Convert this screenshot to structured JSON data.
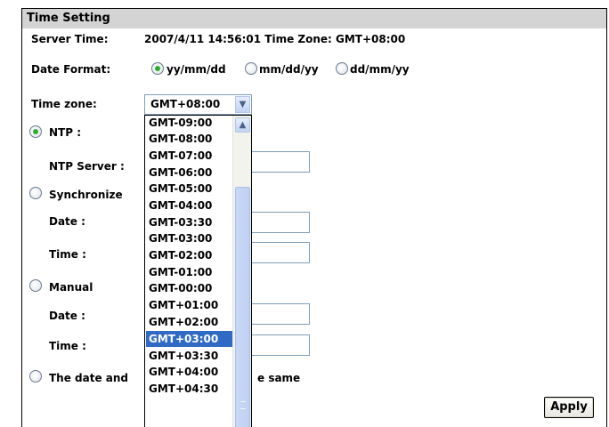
{
  "section_title": "Time Setting",
  "server_time": {
    "label": "Server Time:",
    "value": "2007/4/11 14:56:01 Time Zone: GMT+08:00"
  },
  "date_format": {
    "label": "Date Format:",
    "options": [
      "yy/mm/dd",
      "mm/dd/yy",
      "dd/mm/yy"
    ],
    "selected": "yy/mm/dd"
  },
  "time_zone": {
    "label": "Time zone:",
    "selected": "GMT+08:00",
    "highlighted": "GMT+03:00",
    "visible_options": [
      "GMT-09:00",
      "GMT-08:00",
      "GMT-07:00",
      "GMT-06:00",
      "GMT-05:00",
      "GMT-04:00",
      "GMT-03:30",
      "GMT-03:00",
      "GMT-02:00",
      "GMT-01:00",
      "GMT-00:00",
      "GMT+01:00",
      "GMT+02:00",
      "GMT+03:00",
      "GMT+03:30",
      "GMT+04:00",
      "GMT+04:30"
    ]
  },
  "modes": {
    "ntp": {
      "label": "NTP :",
      "server_label": "NTP Server :"
    },
    "synchronize": {
      "label": "Synchronize",
      "date_label": "Date :",
      "time_label": "Time :"
    },
    "manual": {
      "label": "Manual",
      "date_label": "Date :",
      "time_label": "Time :"
    },
    "same": {
      "label_left": "The date and",
      "label_right": "e same"
    }
  },
  "apply_label": "Apply",
  "colors": {
    "header_bg": "#d4d4d4",
    "selection": "#316ac5",
    "radio_dot": "#2ab02a"
  }
}
